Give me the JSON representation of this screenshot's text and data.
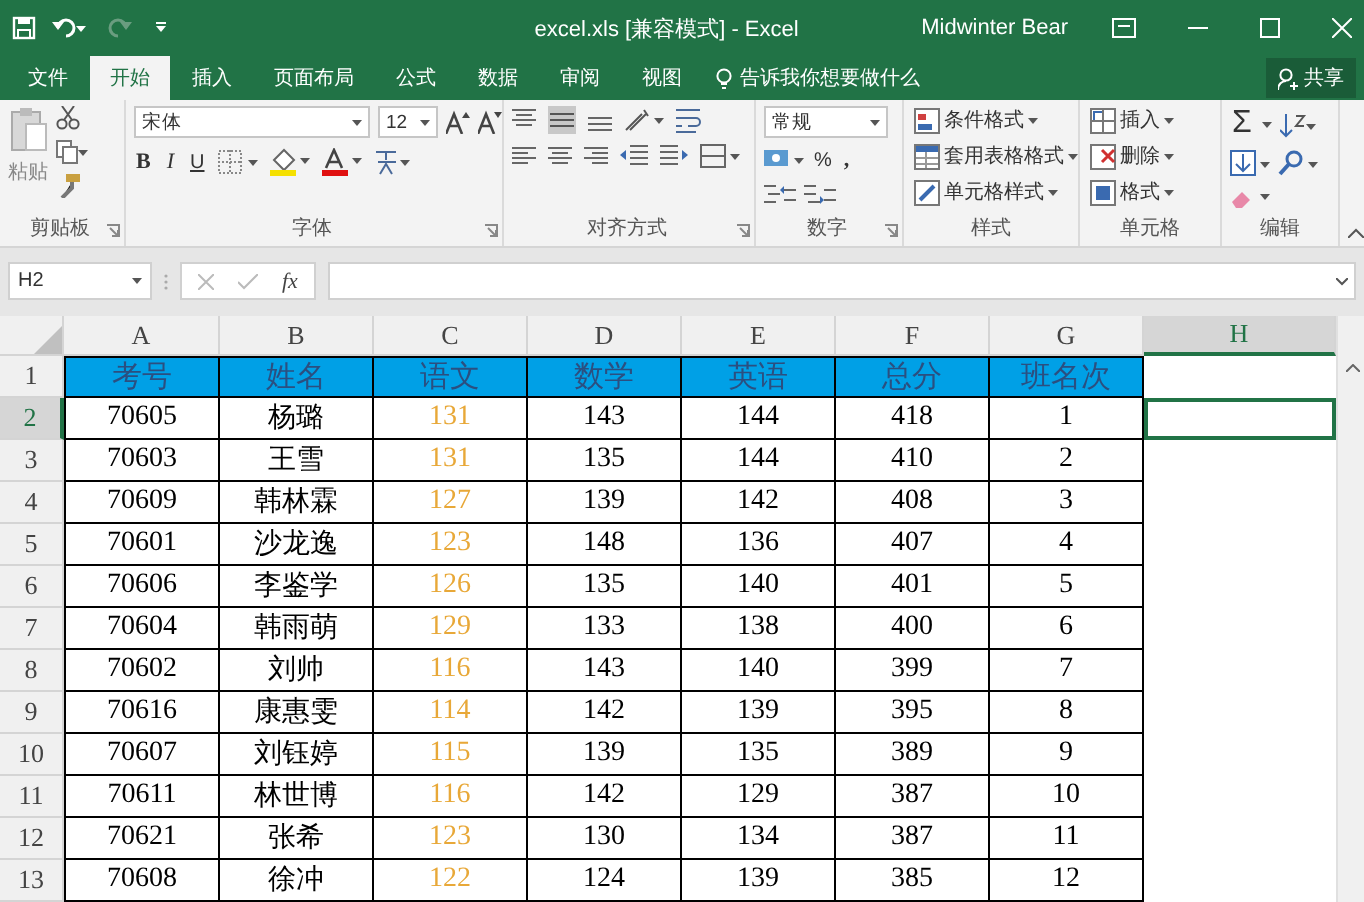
{
  "title_bar": {
    "title": "excel.xls  [兼容模式]  -  Excel",
    "user": "Midwinter Bear"
  },
  "tabs": [
    {
      "label": "文件",
      "selected": false
    },
    {
      "label": "开始",
      "selected": true
    },
    {
      "label": "插入",
      "selected": false
    },
    {
      "label": "页面布局",
      "selected": false
    },
    {
      "label": "公式",
      "selected": false
    },
    {
      "label": "数据",
      "selected": false
    },
    {
      "label": "审阅",
      "selected": false
    },
    {
      "label": "视图",
      "selected": false
    }
  ],
  "tell_me": "告诉我你想要做什么",
  "share": "共享",
  "ribbon": {
    "groups": [
      {
        "kind": "clipboard",
        "label": "剪贴板",
        "paste": "粘贴"
      },
      {
        "kind": "font",
        "label": "字体",
        "font": "宋体",
        "size": "12",
        "bold": "B",
        "italic": "I",
        "underline": "U"
      },
      {
        "kind": "alignment",
        "label": "对齐方式"
      },
      {
        "kind": "number",
        "label": "数字",
        "format": "常规",
        "percent": "%",
        "comma": ","
      },
      {
        "kind": "styles",
        "label": "样式",
        "items": [
          "条件格式",
          "套用表格格式",
          "单元格样式"
        ]
      },
      {
        "kind": "cells",
        "label": "单元格",
        "items": [
          "插入",
          "删除",
          "格式"
        ]
      },
      {
        "kind": "editing",
        "label": "编辑",
        "sum": "Σ"
      }
    ]
  },
  "formula_bar": {
    "name_box": "H2",
    "function_label": "fx"
  },
  "sheet": {
    "columns": [
      {
        "letter": "A",
        "selected": false
      },
      {
        "letter": "B",
        "selected": false
      },
      {
        "letter": "C",
        "selected": false,
        "color": "#e8a838"
      },
      {
        "letter": "D",
        "selected": false
      },
      {
        "letter": "E",
        "selected": false
      },
      {
        "letter": "F",
        "selected": false
      },
      {
        "letter": "G",
        "selected": false
      },
      {
        "letter": "H",
        "selected": true
      }
    ],
    "rows": [
      {
        "number": "1",
        "kind": "header",
        "selected": false,
        "cells": [
          "考号",
          "姓名",
          "语文",
          "数学",
          "英语",
          "总分",
          "班名次"
        ]
      },
      {
        "number": "2",
        "kind": "data",
        "selected": true,
        "cells": [
          "70605",
          "杨璐",
          "131",
          "143",
          "144",
          "418",
          "1"
        ]
      },
      {
        "number": "3",
        "kind": "data",
        "selected": false,
        "cells": [
          "70603",
          "王雪",
          "131",
          "135",
          "144",
          "410",
          "2"
        ]
      },
      {
        "number": "4",
        "kind": "data",
        "selected": false,
        "cells": [
          "70609",
          "韩林霖",
          "127",
          "139",
          "142",
          "408",
          "3"
        ]
      },
      {
        "number": "5",
        "kind": "data",
        "selected": false,
        "cells": [
          "70601",
          "沙龙逸",
          "123",
          "148",
          "136",
          "407",
          "4"
        ]
      },
      {
        "number": "6",
        "kind": "data",
        "selected": false,
        "cells": [
          "70606",
          "李鉴学",
          "126",
          "135",
          "140",
          "401",
          "5"
        ]
      },
      {
        "number": "7",
        "kind": "data",
        "selected": false,
        "cells": [
          "70604",
          "韩雨萌",
          "129",
          "133",
          "138",
          "400",
          "6"
        ]
      },
      {
        "number": "8",
        "kind": "data",
        "selected": false,
        "cells": [
          "70602",
          "刘帅",
          "116",
          "143",
          "140",
          "399",
          "7"
        ]
      },
      {
        "number": "9",
        "kind": "data",
        "selected": false,
        "cells": [
          "70616",
          "康惠雯",
          "114",
          "142",
          "139",
          "395",
          "8"
        ]
      },
      {
        "number": "10",
        "kind": "data",
        "selected": false,
        "cells": [
          "70607",
          "刘钰婷",
          "115",
          "139",
          "135",
          "389",
          "9"
        ]
      },
      {
        "number": "11",
        "kind": "data",
        "selected": false,
        "cells": [
          "70611",
          "林世博",
          "116",
          "142",
          "129",
          "387",
          "10"
        ]
      },
      {
        "number": "12",
        "kind": "data",
        "selected": false,
        "cells": [
          "70621",
          "张希",
          "123",
          "130",
          "134",
          "387",
          "11"
        ]
      },
      {
        "number": "13",
        "kind": "data",
        "selected": false,
        "cells": [
          "70608",
          "徐冲",
          "122",
          "124",
          "139",
          "385",
          "12"
        ]
      }
    ]
  }
}
